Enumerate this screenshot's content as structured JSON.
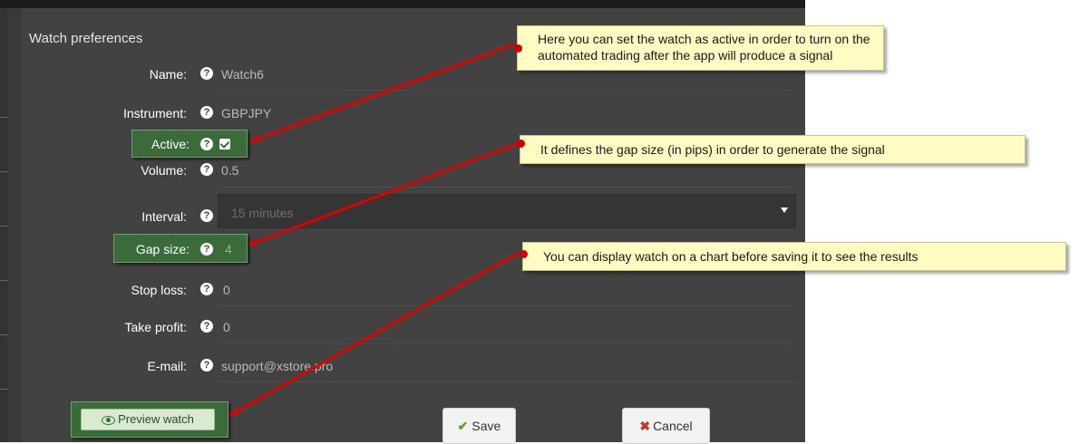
{
  "panel": {
    "title": "Watch preferences"
  },
  "help_glyph": "?",
  "form": {
    "name": {
      "label": "Name:",
      "value": "Watch6"
    },
    "instrument": {
      "label": "Instrument:",
      "value": "GBPJPY"
    },
    "active": {
      "label": "Active:",
      "checked": true
    },
    "volume": {
      "label": "Volume:",
      "value": "0.5"
    },
    "interval": {
      "label": "Interval:",
      "value": "15 minutes"
    },
    "gap_size": {
      "label": "Gap size:",
      "value": "4"
    },
    "stop_loss": {
      "label": "Stop loss:",
      "value": "0"
    },
    "take_profit": {
      "label": "Take profit:",
      "value": "0"
    },
    "email": {
      "label": "E-mail:",
      "value": "support@xstore.pro"
    }
  },
  "buttons": {
    "preview": "Preview watch",
    "save": "Save",
    "cancel": "Cancel"
  },
  "annotations": {
    "active_note": "Here you can set the watch as active in order to turn on the automated trading after the app will produce a signal",
    "gap_note": "It defines the gap size (in pips) in order to generate the signal",
    "preview_note": "You can display watch on a chart before saving it to see the results"
  },
  "colors": {
    "panel": "#424242",
    "highlight": "#3b6b3b",
    "arrow": "#e00000",
    "note_bg": "#fefbc3"
  },
  "icons": {
    "help": "question-circle-icon",
    "eye": "eye-icon",
    "check": "check-icon",
    "close": "x-icon",
    "caret": "caret-down-icon"
  }
}
